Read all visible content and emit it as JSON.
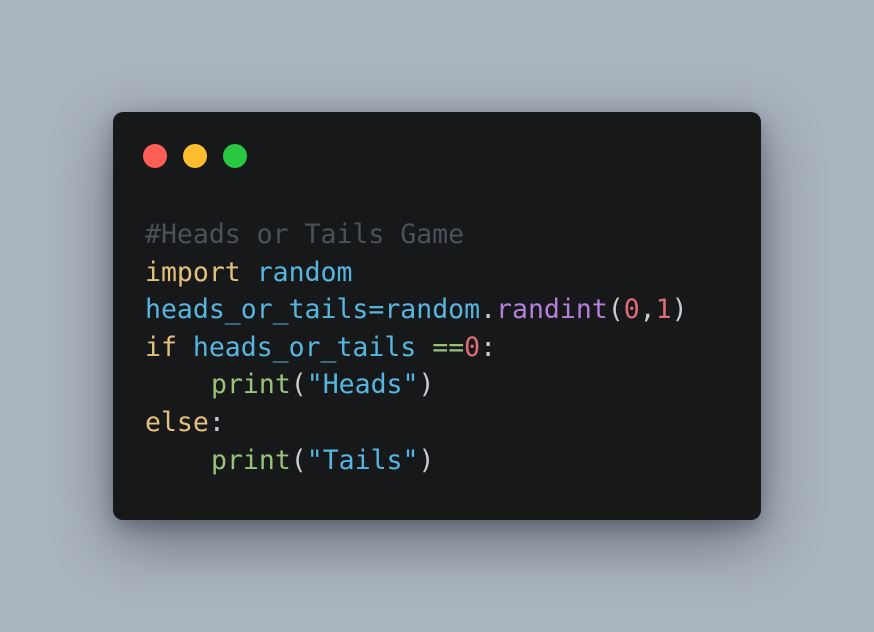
{
  "window": {
    "controls": [
      {
        "name": "close",
        "color": "#ff5f57"
      },
      {
        "name": "minimize",
        "color": "#febc2e"
      },
      {
        "name": "zoom",
        "color": "#28c840"
      }
    ]
  },
  "colors": {
    "comment": "#4a5259",
    "keyword": "#e5c07b",
    "identifier": "#56b6e0",
    "function": "#b57edc",
    "builtin": "#98c379",
    "number": "#e06c75",
    "string": "#56b6e0",
    "punctuation": "#c8ccd2",
    "operator": "#98c379"
  },
  "code": {
    "lines": [
      {
        "indent": 0,
        "tokens": [
          {
            "t": "#Heads or Tails Game",
            "k": "comment"
          }
        ]
      },
      {
        "indent": 0,
        "tokens": [
          {
            "t": "import",
            "k": "keyword"
          },
          {
            "t": " ",
            "k": "punctuation"
          },
          {
            "t": "random",
            "k": "identifier"
          }
        ]
      },
      {
        "indent": 0,
        "tokens": [
          {
            "t": "heads_or_tails",
            "k": "identifier"
          },
          {
            "t": "=",
            "k": "identifier"
          },
          {
            "t": "random",
            "k": "identifier"
          },
          {
            "t": ".",
            "k": "punctuation"
          },
          {
            "t": "randint",
            "k": "function"
          },
          {
            "t": "(",
            "k": "punctuation"
          },
          {
            "t": "0",
            "k": "number"
          },
          {
            "t": ",",
            "k": "punctuation"
          },
          {
            "t": "1",
            "k": "number"
          },
          {
            "t": ")",
            "k": "punctuation"
          }
        ]
      },
      {
        "indent": 0,
        "tokens": [
          {
            "t": "if",
            "k": "keyword"
          },
          {
            "t": " ",
            "k": "punctuation"
          },
          {
            "t": "heads_or_tails",
            "k": "identifier"
          },
          {
            "t": " ",
            "k": "punctuation"
          },
          {
            "t": "==",
            "k": "operator"
          },
          {
            "t": "0",
            "k": "number"
          },
          {
            "t": ":",
            "k": "punctuation"
          }
        ]
      },
      {
        "indent": 1,
        "tokens": [
          {
            "t": "print",
            "k": "builtin"
          },
          {
            "t": "(",
            "k": "punctuation"
          },
          {
            "t": "\"Heads\"",
            "k": "string"
          },
          {
            "t": ")",
            "k": "punctuation"
          }
        ]
      },
      {
        "indent": 0,
        "tokens": [
          {
            "t": "else",
            "k": "keyword"
          },
          {
            "t": ":",
            "k": "punctuation"
          }
        ]
      },
      {
        "indent": 1,
        "tokens": [
          {
            "t": "print",
            "k": "builtin"
          },
          {
            "t": "(",
            "k": "punctuation"
          },
          {
            "t": "\"Tails\"",
            "k": "string"
          },
          {
            "t": ")",
            "k": "punctuation"
          }
        ]
      }
    ]
  }
}
